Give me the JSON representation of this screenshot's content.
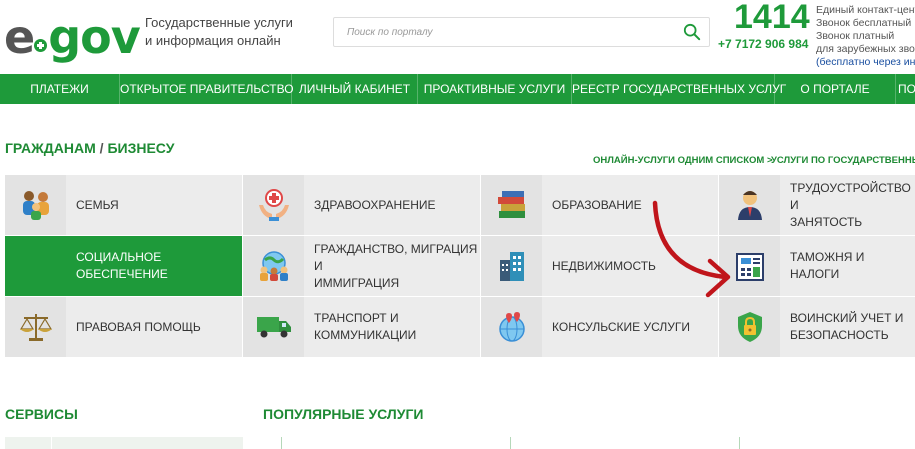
{
  "header": {
    "logo_e": "e",
    "logo_gov": "gov",
    "tagline_line1": "Государственные услуги",
    "tagline_line2": "и информация онлайн",
    "search_placeholder": "Поиск по порталу",
    "phone_short": "1414",
    "phone_long": "+7 7172 906 984",
    "contact_line1": "Единый контакт-центр",
    "contact_line2": "Звонок бесплатный",
    "contact_line3": "Звонок платный",
    "contact_line4": "для зарубежных зво",
    "contact_line5": "(бесплатно через инт"
  },
  "nav": {
    "items": [
      {
        "label": "Платежи"
      },
      {
        "label": "Открытое правительство"
      },
      {
        "label": "Личный кабинет"
      },
      {
        "label": "Проактивные услуги"
      },
      {
        "label": "Реестр государственных услуг"
      },
      {
        "label": "О портале"
      },
      {
        "label": "По"
      }
    ]
  },
  "main": {
    "title_citizens": "Гражданам",
    "title_sep": " / ",
    "title_business": "Бизнесу",
    "link_online": "Онлайн-услуги одним списком >",
    "link_by_agency": "Услуги по государственным о",
    "categories": [
      {
        "label_1": "Семья",
        "label_2": ""
      },
      {
        "label_1": "Здравоохранение",
        "label_2": ""
      },
      {
        "label_1": "Образование",
        "label_2": ""
      },
      {
        "label_1": "Трудоустройство и",
        "label_2": "занятость"
      },
      {
        "label_1": "Социальное",
        "label_2": "обеспечение"
      },
      {
        "label_1": "Гражданство, миграция и",
        "label_2": "иммиграция"
      },
      {
        "label_1": "Недвижимость",
        "label_2": ""
      },
      {
        "label_1": "Таможня и налоги",
        "label_2": ""
      },
      {
        "label_1": "Правовая помощь",
        "label_2": ""
      },
      {
        "label_1": "Транспорт и",
        "label_2": "коммуникации"
      },
      {
        "label_1": "Консульские услуги",
        "label_2": ""
      },
      {
        "label_1": "Воинский учет и",
        "label_2": "безопасность"
      }
    ],
    "services_title": "Сервисы",
    "popular_title": "Популярные услуги"
  },
  "colors": {
    "brand_green": "#1e9a3a",
    "annotation_arrow": "#c0151b",
    "tile_bg": "#ececec"
  },
  "icons": {
    "search": "search-icon",
    "family": "family-icon",
    "health": "health-hands-icon",
    "education": "books-icon",
    "employment": "worker-icon",
    "social": "social-icon",
    "citizenship": "people-globe-icon",
    "realty": "buildings-icon",
    "customs": "calculator-document-icon",
    "legal": "scales-icon",
    "transport": "truck-icon",
    "consular": "globe-pin-icon",
    "military": "shield-lock-icon"
  }
}
